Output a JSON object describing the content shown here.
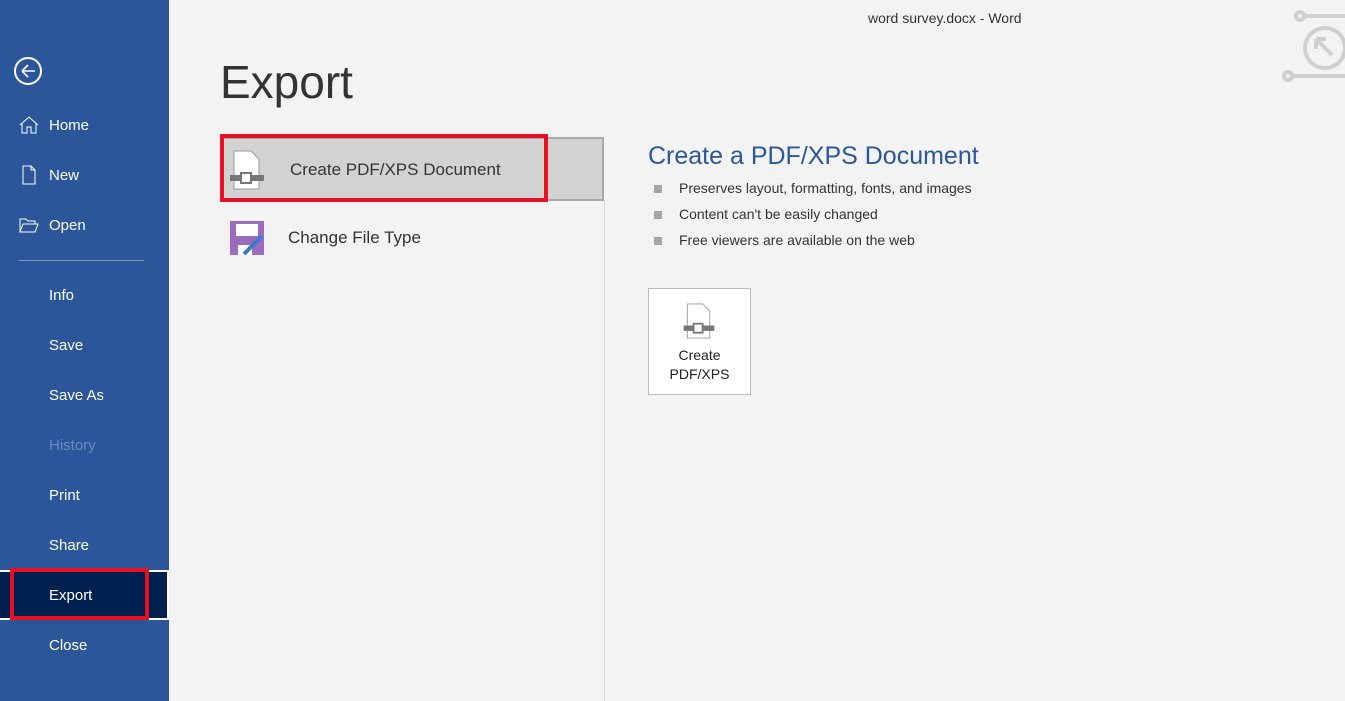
{
  "window": {
    "title": "word survey.docx  -  Word"
  },
  "sidebar": {
    "items": [
      {
        "label": "Home",
        "icon": "home-icon"
      },
      {
        "label": "New",
        "icon": "new-document-icon"
      },
      {
        "label": "Open",
        "icon": "folder-open-icon"
      },
      {
        "label": "Info"
      },
      {
        "label": "Save"
      },
      {
        "label": "Save As"
      },
      {
        "label": "History",
        "disabled": true
      },
      {
        "label": "Print"
      },
      {
        "label": "Share"
      },
      {
        "label": "Export",
        "selected": true
      },
      {
        "label": "Close"
      }
    ]
  },
  "main": {
    "title": "Export",
    "options": [
      {
        "label": "Create PDF/XPS Document",
        "selected": true
      },
      {
        "label": "Change File Type"
      }
    ],
    "detail": {
      "title": "Create a PDF/XPS Document",
      "bullets": [
        "Preserves layout, formatting, fonts, and images",
        "Content can't be easily changed",
        "Free viewers are available on the web"
      ],
      "button_line1": "Create",
      "button_line2": "PDF/XPS"
    }
  },
  "colors": {
    "sidebar": "#2b579a",
    "selected": "#002050",
    "highlight": "#e81123",
    "accent": "#2b579a"
  }
}
